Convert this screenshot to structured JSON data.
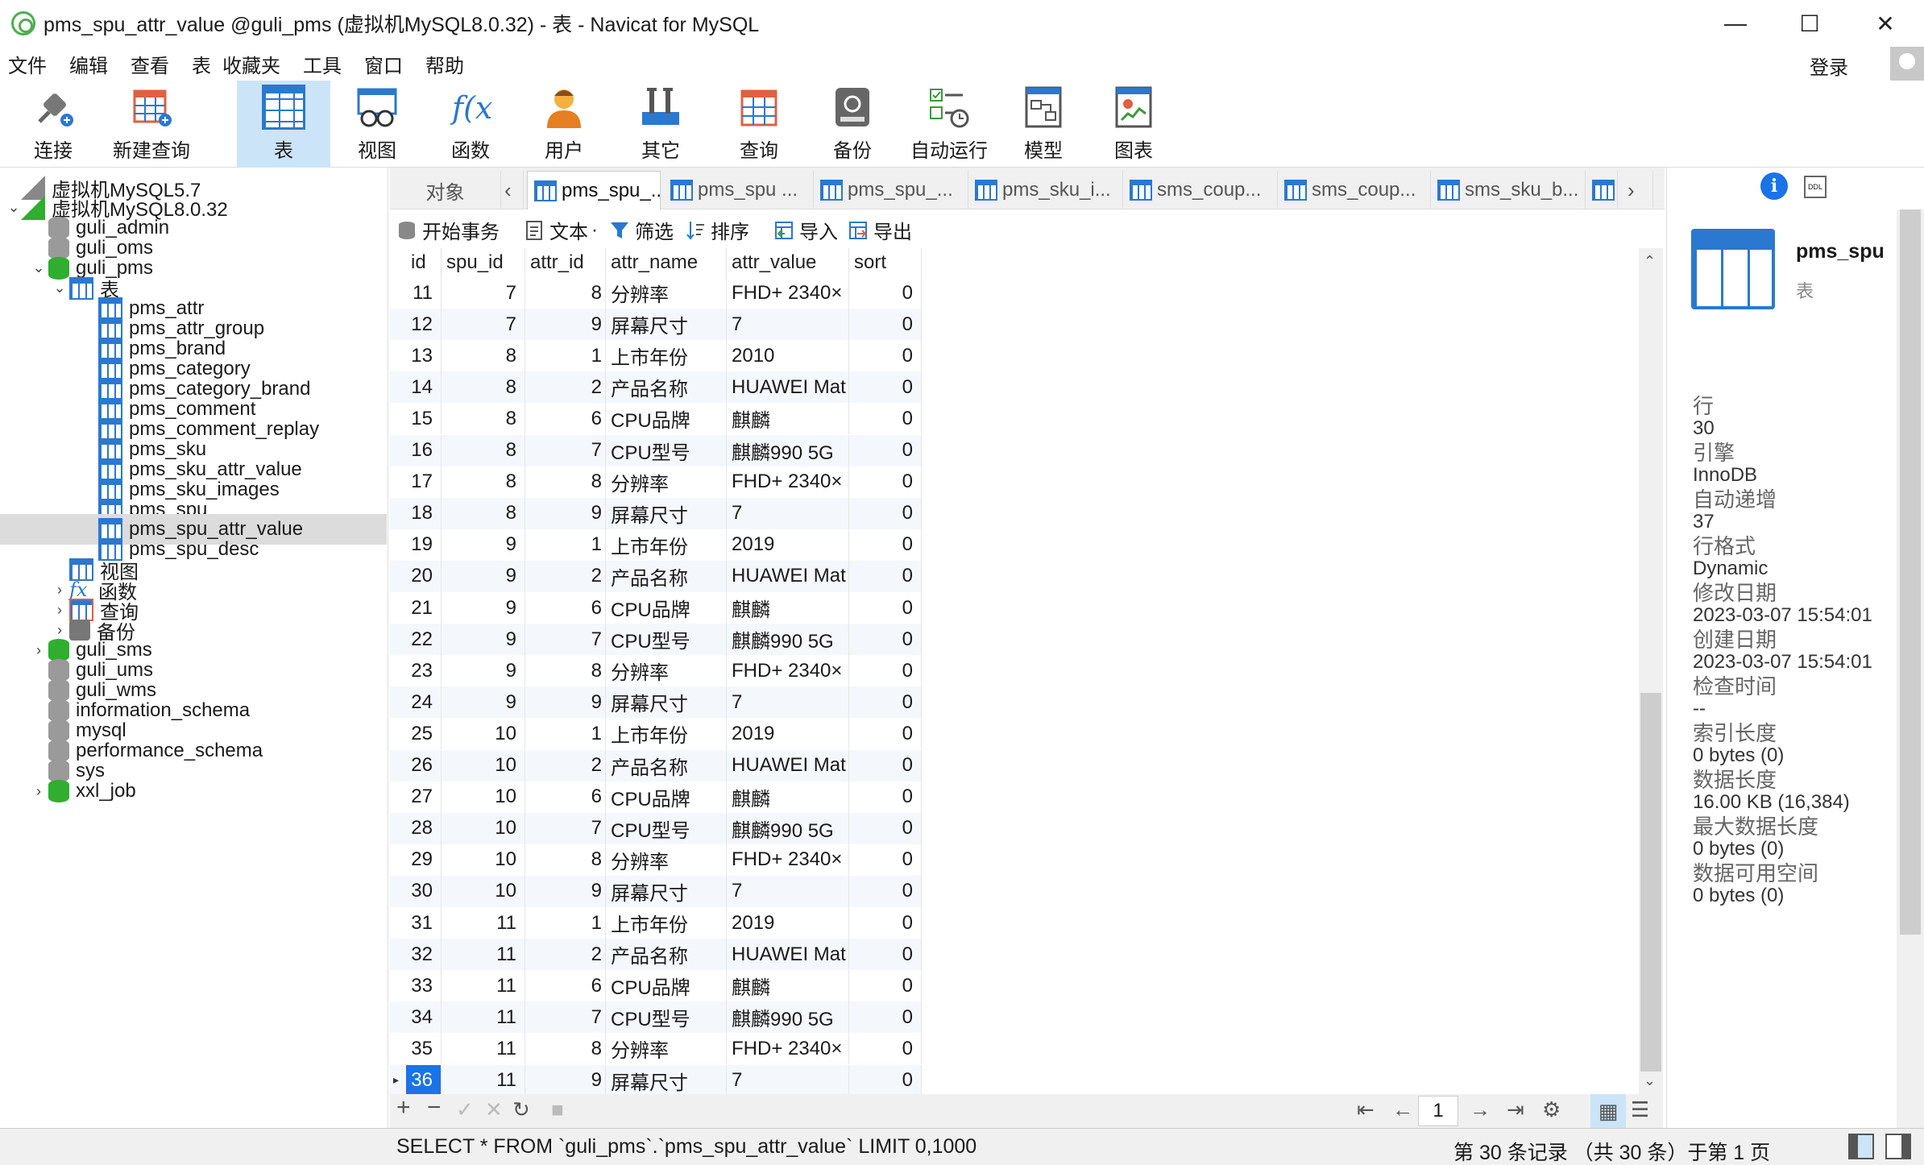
{
  "window": {
    "title": "pms_spu_attr_value @guli_pms (虚拟机MySQL8.0.32) - 表 - Navicat for MySQL"
  },
  "menu": [
    "文件",
    "编辑",
    "查看",
    "表",
    "收藏夹",
    "工具",
    "窗口",
    "帮助"
  ],
  "login": "登录",
  "toolbar": [
    {
      "label": "连接",
      "icon": "plug-icon"
    },
    {
      "label": "新建查询",
      "icon": "new-query-icon"
    },
    {
      "label": "表",
      "icon": "table-icon"
    },
    {
      "label": "视图",
      "icon": "view-icon"
    },
    {
      "label": "函数",
      "icon": "function-icon"
    },
    {
      "label": "用户",
      "icon": "user-icon"
    },
    {
      "label": "其它",
      "icon": "tools-icon"
    },
    {
      "label": "查询",
      "icon": "query-icon"
    },
    {
      "label": "备份",
      "icon": "backup-icon"
    },
    {
      "label": "自动运行",
      "icon": "schedule-icon"
    },
    {
      "label": "模型",
      "icon": "model-icon"
    },
    {
      "label": "图表",
      "icon": "chart-icon"
    }
  ],
  "tree": [
    {
      "label": "虚拟机MySQL5.7",
      "level": 0,
      "type": "server-off",
      "arrow": ""
    },
    {
      "label": "虚拟机MySQL8.0.32",
      "level": 0,
      "type": "server",
      "arrow": "∨"
    },
    {
      "label": "guli_admin",
      "level": 1,
      "type": "db",
      "arrow": ""
    },
    {
      "label": "guli_oms",
      "level": 1,
      "type": "db",
      "arrow": ""
    },
    {
      "label": "guli_pms",
      "level": 1,
      "type": "db-open",
      "arrow": "∨"
    },
    {
      "label": "表",
      "level": 2,
      "type": "table",
      "arrow": "∨"
    },
    {
      "label": "pms_attr",
      "level": 3,
      "type": "table",
      "arrow": ""
    },
    {
      "label": "pms_attr_group",
      "level": 3,
      "type": "table",
      "arrow": ""
    },
    {
      "label": "pms_brand",
      "level": 3,
      "type": "table",
      "arrow": ""
    },
    {
      "label": "pms_category",
      "level": 3,
      "type": "table",
      "arrow": ""
    },
    {
      "label": "pms_category_brand",
      "level": 3,
      "type": "table",
      "arrow": ""
    },
    {
      "label": "pms_comment",
      "level": 3,
      "type": "table",
      "arrow": ""
    },
    {
      "label": "pms_comment_replay",
      "level": 3,
      "type": "table",
      "arrow": ""
    },
    {
      "label": "pms_sku",
      "level": 3,
      "type": "table",
      "arrow": ""
    },
    {
      "label": "pms_sku_attr_value",
      "level": 3,
      "type": "table",
      "arrow": ""
    },
    {
      "label": "pms_sku_images",
      "level": 3,
      "type": "table",
      "arrow": ""
    },
    {
      "label": "pms_spu",
      "level": 3,
      "type": "table",
      "arrow": ""
    },
    {
      "label": "pms_spu_attr_value",
      "level": 3,
      "type": "table",
      "arrow": "",
      "selected": true
    },
    {
      "label": "pms_spu_desc",
      "level": 3,
      "type": "table",
      "arrow": ""
    },
    {
      "label": "视图",
      "level": 2,
      "type": "view",
      "arrow": ""
    },
    {
      "label": "函数",
      "level": 2,
      "type": "func",
      "arrow": ">"
    },
    {
      "label": "查询",
      "level": 2,
      "type": "query",
      "arrow": ">"
    },
    {
      "label": "备份",
      "level": 2,
      "type": "backup",
      "arrow": ">"
    },
    {
      "label": "guli_sms",
      "level": 1,
      "type": "db-open",
      "arrow": ">"
    },
    {
      "label": "guli_ums",
      "level": 1,
      "type": "db",
      "arrow": ""
    },
    {
      "label": "guli_wms",
      "level": 1,
      "type": "db",
      "arrow": ""
    },
    {
      "label": "information_schema",
      "level": 1,
      "type": "db",
      "arrow": ""
    },
    {
      "label": "mysql",
      "level": 1,
      "type": "db",
      "arrow": ""
    },
    {
      "label": "performance_schema",
      "level": 1,
      "type": "db",
      "arrow": ""
    },
    {
      "label": "sys",
      "level": 1,
      "type": "db",
      "arrow": ""
    },
    {
      "label": "xxl_job",
      "level": 1,
      "type": "db-open",
      "arrow": ">"
    }
  ],
  "tabs": {
    "objects": "对象",
    "items": [
      "pms_spu_...",
      "pms_spu ...",
      "pms_spu_...",
      "pms_sku_i...",
      "sms_coup...",
      "sms_coup...",
      "sms_sku_b..."
    ]
  },
  "actions": [
    "开始事务",
    "文本",
    "筛选",
    "排序",
    "导入",
    "导出"
  ],
  "grid": {
    "columns": [
      "id",
      "spu_id",
      "attr_id",
      "attr_name",
      "attr_value",
      "sort"
    ],
    "rows": [
      [
        "11",
        "7",
        "8",
        "分辨率",
        "FHD+ 2340×",
        "0"
      ],
      [
        "12",
        "7",
        "9",
        "屏幕尺寸",
        "7",
        "0"
      ],
      [
        "13",
        "8",
        "1",
        "上市年份",
        "2010",
        "0"
      ],
      [
        "14",
        "8",
        "2",
        "产品名称",
        "HUAWEI Mat",
        "0"
      ],
      [
        "15",
        "8",
        "6",
        "CPU品牌",
        "麒麟",
        "0"
      ],
      [
        "16",
        "8",
        "7",
        "CPU型号",
        "麒麟990 5G",
        "0"
      ],
      [
        "17",
        "8",
        "8",
        "分辨率",
        "FHD+ 2340×",
        "0"
      ],
      [
        "18",
        "8",
        "9",
        "屏幕尺寸",
        "7",
        "0"
      ],
      [
        "19",
        "9",
        "1",
        "上市年份",
        "2019",
        "0"
      ],
      [
        "20",
        "9",
        "2",
        "产品名称",
        "HUAWEI Mat",
        "0"
      ],
      [
        "21",
        "9",
        "6",
        "CPU品牌",
        "麒麟",
        "0"
      ],
      [
        "22",
        "9",
        "7",
        "CPU型号",
        "麒麟990 5G",
        "0"
      ],
      [
        "23",
        "9",
        "8",
        "分辨率",
        "FHD+ 2340×",
        "0"
      ],
      [
        "24",
        "9",
        "9",
        "屏幕尺寸",
        "7",
        "0"
      ],
      [
        "25",
        "10",
        "1",
        "上市年份",
        "2019",
        "0"
      ],
      [
        "26",
        "10",
        "2",
        "产品名称",
        "HUAWEI Mat",
        "0"
      ],
      [
        "27",
        "10",
        "6",
        "CPU品牌",
        "麒麟",
        "0"
      ],
      [
        "28",
        "10",
        "7",
        "CPU型号",
        "麒麟990 5G",
        "0"
      ],
      [
        "29",
        "10",
        "8",
        "分辨率",
        "FHD+ 2340×",
        "0"
      ],
      [
        "30",
        "10",
        "9",
        "屏幕尺寸",
        "7",
        "0"
      ],
      [
        "31",
        "11",
        "1",
        "上市年份",
        "2019",
        "0"
      ],
      [
        "32",
        "11",
        "2",
        "产品名称",
        "HUAWEI Mat",
        "0"
      ],
      [
        "33",
        "11",
        "6",
        "CPU品牌",
        "麒麟",
        "0"
      ],
      [
        "34",
        "11",
        "7",
        "CPU型号",
        "麒麟990 5G",
        "0"
      ],
      [
        "35",
        "11",
        "8",
        "分辨率",
        "FHD+ 2340×",
        "0"
      ],
      [
        "36",
        "11",
        "9",
        "屏幕尺寸",
        "7",
        "0"
      ]
    ],
    "selected_id": "36"
  },
  "pager": {
    "page": "1"
  },
  "info": {
    "name": "pms_spu",
    "type": "表",
    "props": [
      {
        "label": "行",
        "value": "30"
      },
      {
        "label": "引擎",
        "value": "InnoDB"
      },
      {
        "label": "自动递增",
        "value": "37"
      },
      {
        "label": "行格式",
        "value": "Dynamic"
      },
      {
        "label": "修改日期",
        "value": "2023-03-07 15:54:01"
      },
      {
        "label": "创建日期",
        "value": "2023-03-07 15:54:01"
      },
      {
        "label": "检查时间",
        "value": "--"
      },
      {
        "label": "索引长度",
        "value": "0 bytes (0)"
      },
      {
        "label": "数据长度",
        "value": "16.00 KB (16,384)"
      },
      {
        "label": "最大数据长度",
        "value": "0 bytes (0)"
      },
      {
        "label": "数据可用空间",
        "value": "0 bytes (0)"
      }
    ]
  },
  "status": {
    "sql": "SELECT * FROM `guli_pms`.`pms_spu_attr_value` LIMIT 0,1000",
    "records": "第 30 条记录 （共 30 条）于第 1 页"
  }
}
